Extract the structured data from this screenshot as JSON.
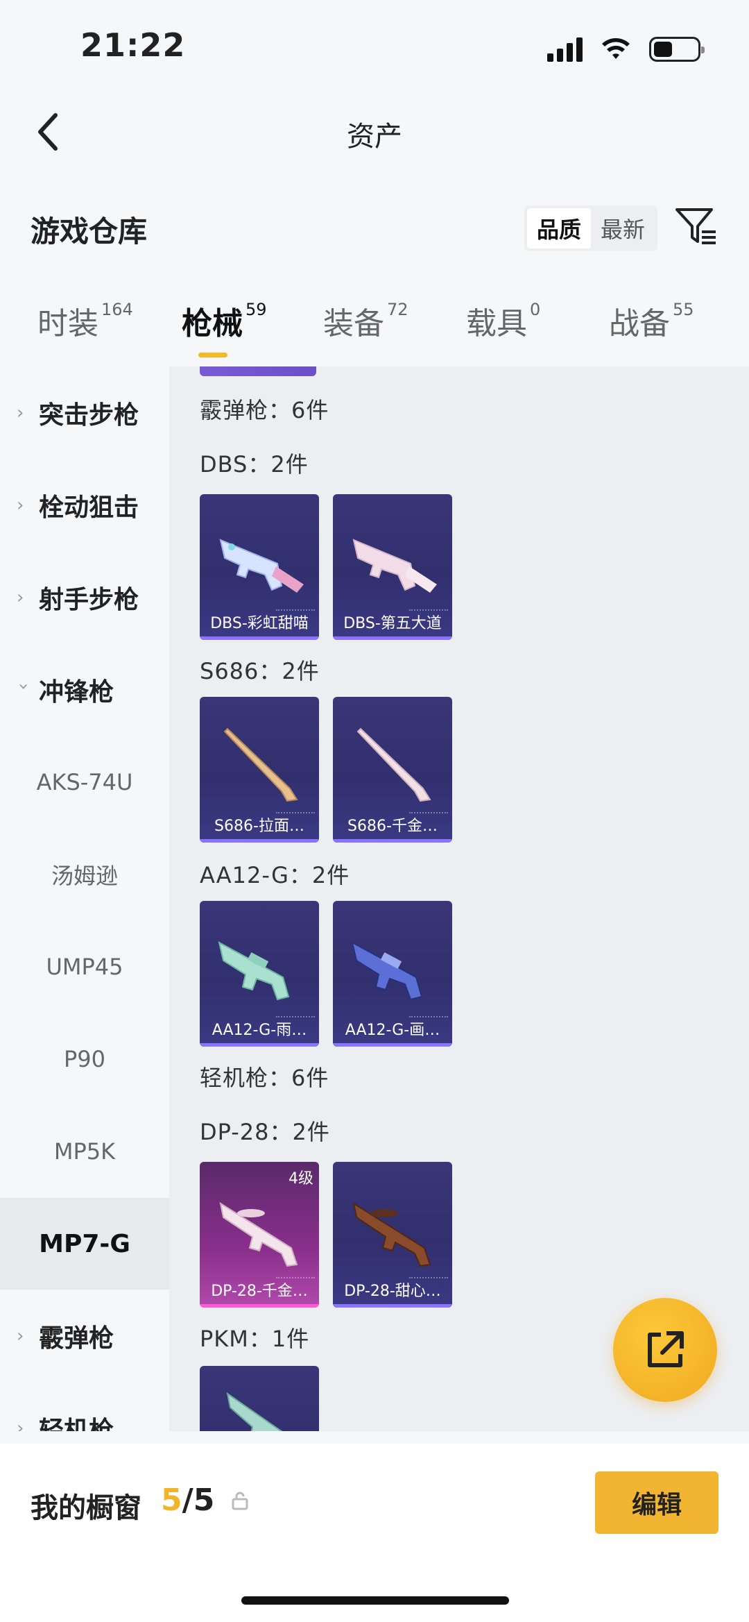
{
  "status": {
    "time": "21:22"
  },
  "header": {
    "title": "资产"
  },
  "section": {
    "title": "游戏仓库",
    "sort": [
      "品质",
      "最新"
    ]
  },
  "tabs": [
    {
      "label": "时装",
      "count": "164"
    },
    {
      "label": "枪械",
      "count": "59"
    },
    {
      "label": "装备",
      "count": "72"
    },
    {
      "label": "载具",
      "count": "0"
    },
    {
      "label": "战备",
      "count": "55"
    }
  ],
  "sidebar": {
    "categories": [
      "突击步枪",
      "栓动狙击",
      "射手步枪",
      "冲锋枪"
    ],
    "subs": [
      "AKS-74U",
      "汤姆逊",
      "UMP45",
      "P90",
      "MP5K",
      "MP7-G"
    ],
    "after": [
      "霰弹枪",
      "轻机枪"
    ]
  },
  "content": {
    "g1": "霰弹枪：6件",
    "g2": "DBS：2件",
    "g3": "S686：2件",
    "g4": "AA12-G：2件",
    "g5": "轻机枪：6件",
    "g6": "DP-28：2件",
    "g7": "PKM：1件",
    "cards": {
      "c1": "DBS-彩虹甜喵",
      "c2": "DBS-第五大道",
      "c3": "S686-拉面…",
      "c4": "S686-千金…",
      "c5": "AA12-G-雨…",
      "c6": "AA12-G-画…",
      "c7": "DP-28-千金…",
      "c8": "DP-28-甜心…",
      "c7_level": "4级"
    }
  },
  "bottom": {
    "label": "我的橱窗",
    "current": "5",
    "sep": "/5",
    "edit": "编辑"
  },
  "colors": {
    "accent": "#f2b531",
    "card_purple": "#3a3678",
    "card_pink": "#b14aac"
  }
}
